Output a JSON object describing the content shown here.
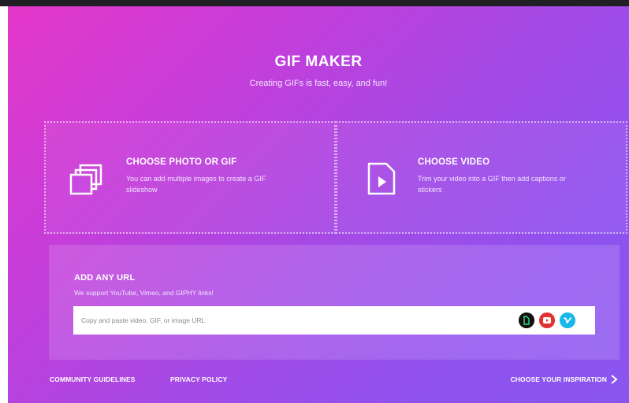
{
  "header": {
    "title": "GIF MAKER",
    "subtitle": "Creating GIFs is fast, easy, and fun!"
  },
  "choose_photo": {
    "heading": "CHOOSE PHOTO OR GIF",
    "description": "You can add multiple images to create a GIF slideshow",
    "icon": "images-icon"
  },
  "choose_video": {
    "heading": "CHOOSE VIDEO",
    "description": "Trim your video into a GIF then add captions or stickers",
    "icon": "video-file-icon"
  },
  "url_section": {
    "heading": "ADD ANY URL",
    "subheading": "We support YouTube, Vimeo, and GIPHY links!",
    "placeholder": "Copy and paste video, GIF, or image URL",
    "value": "",
    "source_icons": [
      "giphy-icon",
      "youtube-icon",
      "vimeo-icon"
    ]
  },
  "footer": {
    "community_guidelines": "COMMUNITY GUIDELINES",
    "privacy_policy": "PRIVACY POLICY",
    "choose_inspiration": "CHOOSE YOUR INSPIRATION"
  },
  "colors": {
    "gradient_start": "#e438c9",
    "gradient_end": "#8a55ef",
    "youtube": "#e33030",
    "vimeo": "#19b7ea",
    "giphy": "#111111"
  }
}
